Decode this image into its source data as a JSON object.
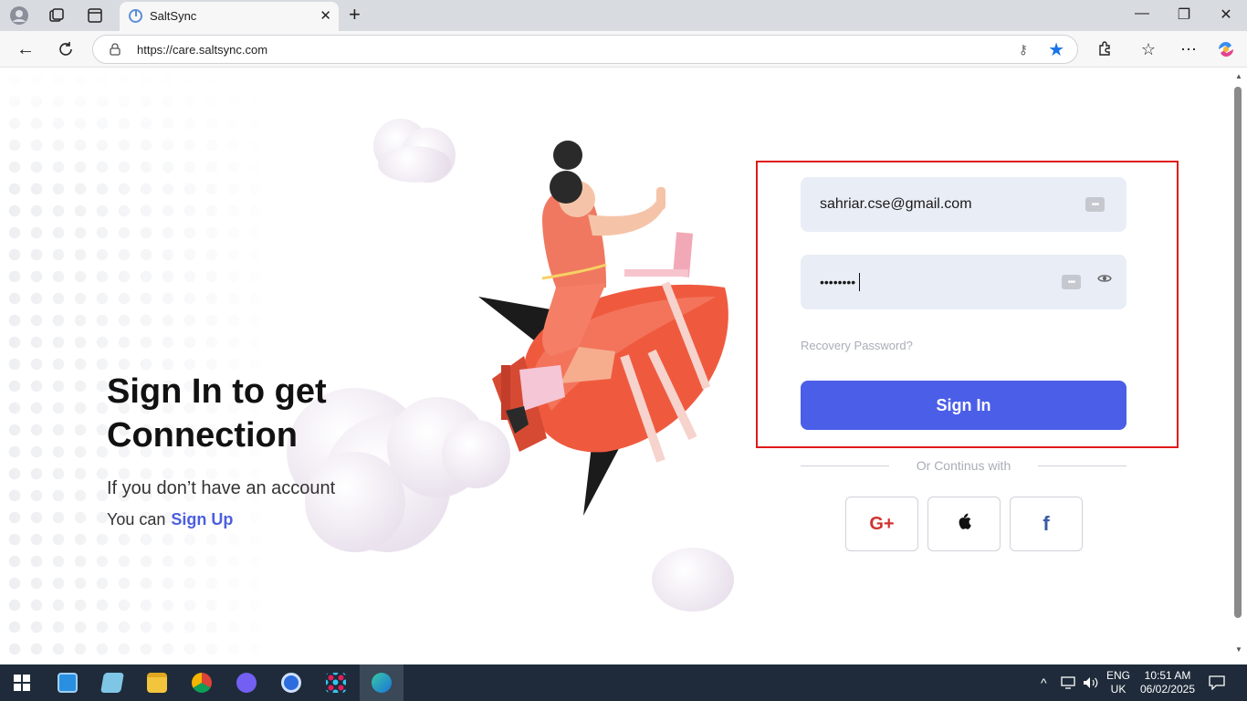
{
  "browser": {
    "tab_title": "SaltSync",
    "url": "https://care.saltsync.com"
  },
  "hero": {
    "title_line1": "Sign In to get",
    "title_line2": "Connection",
    "subtitle": "If you don’t have an account",
    "signup_prefix": "You can",
    "signup_link": "Sign Up"
  },
  "form": {
    "email_value": "sahriar.cse@gmail.com",
    "password_value": "••••••••",
    "recovery_label": "Recovery Password?",
    "signin_label": "Sign In",
    "or_continue": "Or Continus with"
  },
  "social": {
    "google_label": "G+",
    "apple_label": "",
    "facebook_label": "f"
  },
  "taskbar": {
    "lang_line1": "ENG",
    "lang_line2": "UK",
    "time": "10:51 AM",
    "date": "06/02/2025"
  },
  "colors": {
    "accent": "#4a5ee8",
    "highlight_border": "#e01a1a"
  }
}
